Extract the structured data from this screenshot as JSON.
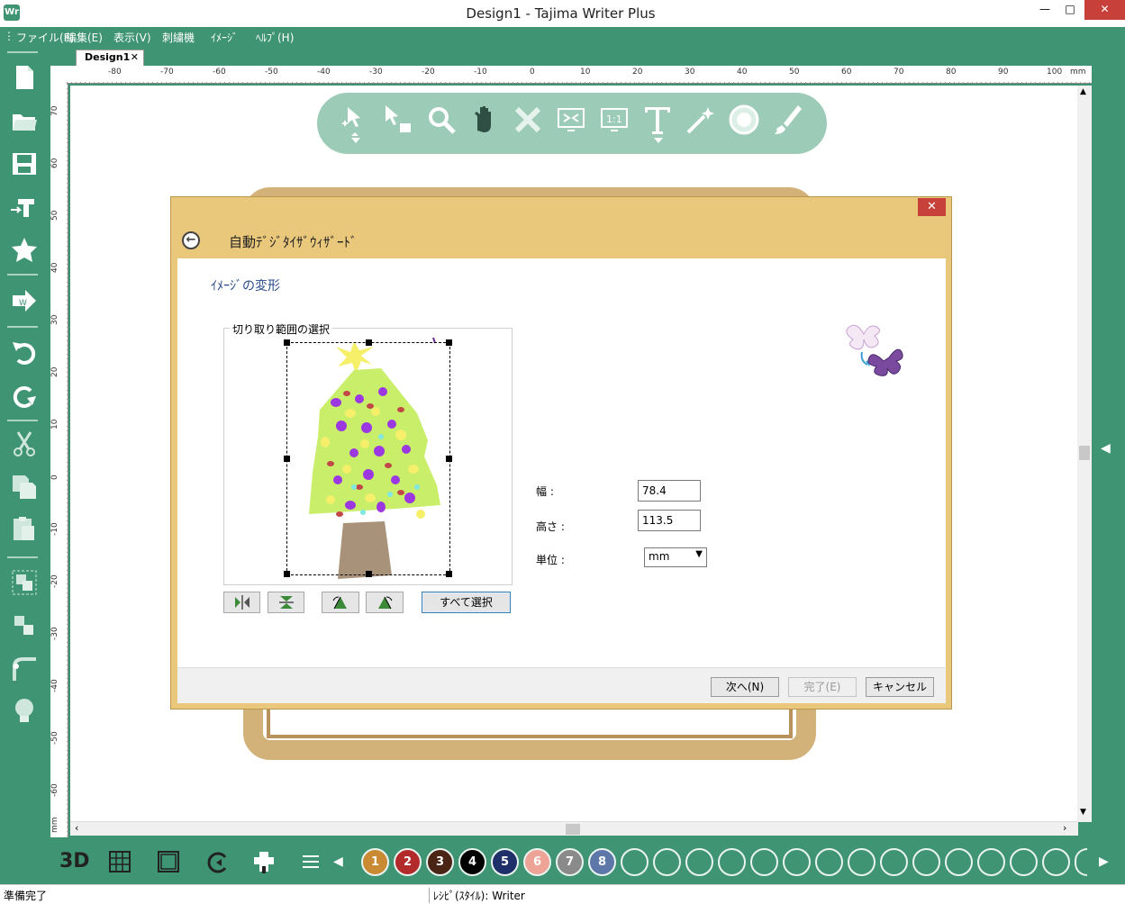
{
  "window": {
    "title": "Design1 - Tajima Writer Plus",
    "app_icon": "Wr",
    "minimize": "—",
    "maximize": "□",
    "close": "✕"
  },
  "menu": {
    "items": [
      "ファイル(F)",
      "編集(E)",
      "表示(V)",
      "刺繍機",
      "ｲﾒｰｼﾞ",
      "ﾍﾙﾌﾟ(H)"
    ]
  },
  "tab": {
    "label": "Design1",
    "close": "✕"
  },
  "ruler": {
    "unit": "mm",
    "top_labels": [
      "-80",
      "-70",
      "-60",
      "-50",
      "-40",
      "-30",
      "-20",
      "-10",
      "0",
      "10",
      "20",
      "30",
      "40",
      "50",
      "60",
      "70",
      "80",
      "90",
      "100"
    ],
    "left_labels": [
      "70",
      "60",
      "50",
      "40",
      "30",
      "20",
      "10",
      "0",
      "-10",
      "-20",
      "-30",
      "-40",
      "-50",
      "-60"
    ]
  },
  "left_toolbar": {
    "icons": [
      "new-file-icon",
      "open-folder-icon",
      "save-icon",
      "send-to-machine-icon",
      "star-icon",
      "export-icon",
      "undo-icon",
      "redo-icon",
      "cut-icon",
      "copy-icon",
      "paste-icon",
      "group-icon",
      "ungroup-icon",
      "node-edit-icon",
      "bulb-icon"
    ]
  },
  "float_toolbar": {
    "icons": [
      "transform-icon",
      "select-icon",
      "zoom-icon",
      "pan-hand-icon",
      "delete-icon",
      "fit-screen-icon",
      "actual-size-icon",
      "text-icon",
      "magic-wand-icon",
      "circle-icon",
      "brush-icon"
    ],
    "one_to_one": "1:1"
  },
  "wizard": {
    "title": "自動ﾃﾞｼﾞﾀｲｻﾞｳｨｻﾞｰﾄﾞ",
    "close": "✕",
    "back": "←",
    "step_heading": "ｲﾒｰｼﾞの変形",
    "crop_group_label": "切り取り範囲の選択",
    "select_all": "すべて選択",
    "width_label": "幅 :",
    "width_value": "78.4",
    "height_label": "高さ :",
    "height_value": "113.5",
    "unit_label": "単位 :",
    "unit_value": "mm",
    "next": "次へ(N)",
    "finish": "完了(E)",
    "cancel": "キャンセル"
  },
  "bottom_bar": {
    "three_d": "3D",
    "colors": [
      {
        "number": "1",
        "color": "#c98a33"
      },
      {
        "number": "2",
        "color": "#b22a2a"
      },
      {
        "number": "3",
        "color": "#4a2414"
      },
      {
        "number": "4",
        "color": "#000000"
      },
      {
        "number": "5",
        "color": "#1f2f6a"
      },
      {
        "number": "6",
        "color": "#eda496"
      },
      {
        "number": "7",
        "color": "#8a8a8a"
      },
      {
        "number": "8",
        "color": "#5d78a8"
      }
    ]
  },
  "status": {
    "left": "準備完了",
    "middle": "ﾚｼﾋﾟ(ｽﾀｲﾙ): Writer"
  }
}
